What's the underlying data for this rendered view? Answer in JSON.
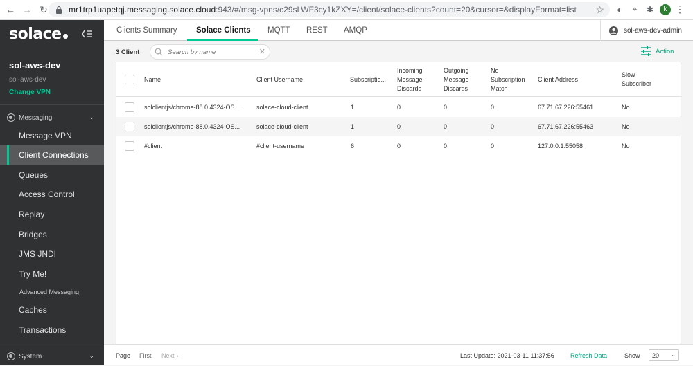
{
  "browser": {
    "url_host": "mr1trp1uapetqj.messaging.solace.cloud",
    "url_rest": ":943/#/msg-vpns/c29sLWF3cy1kZXY=/client/solace-clients?count=20&cursor=&displayFormat=list",
    "profile_initial": "k"
  },
  "sidebar": {
    "logo": "solace",
    "vpn_name": "sol-aws-dev",
    "vpn_sub": "sol-aws-dev",
    "change_vpn": "Change VPN",
    "section_messaging": "Messaging",
    "items": [
      {
        "label": "Message VPN"
      },
      {
        "label": "Client Connections"
      },
      {
        "label": "Queues"
      },
      {
        "label": "Access Control"
      },
      {
        "label": "Replay"
      },
      {
        "label": "Bridges"
      },
      {
        "label": "JMS JNDI"
      },
      {
        "label": "Try Me!"
      },
      {
        "label": "Advanced Messaging"
      },
      {
        "label": "Caches"
      },
      {
        "label": "Transactions"
      }
    ],
    "section_system": "System"
  },
  "tabs": [
    {
      "label": "Clients Summary"
    },
    {
      "label": "Solace Clients"
    },
    {
      "label": "MQTT"
    },
    {
      "label": "REST"
    },
    {
      "label": "AMQP"
    }
  ],
  "user": {
    "name": "sol-aws-dev-admin"
  },
  "toolbar": {
    "count": "3 Client",
    "search_placeholder": "Search by name",
    "action_label": "Action"
  },
  "table": {
    "headers": {
      "name": "Name",
      "username": "Client Username",
      "subscriptions": "Subscriptio...",
      "incoming_1": "Incoming",
      "incoming_2": "Message",
      "incoming_3": "Discards",
      "outgoing_1": "Outgoing",
      "outgoing_2": "Message",
      "outgoing_3": "Discards",
      "nosub_1": "No",
      "nosub_2": "Subscription",
      "nosub_3": "Match",
      "address": "Client Address",
      "slow_1": "Slow",
      "slow_2": "Subscriber"
    },
    "rows": [
      {
        "name": "solclientjs/chrome-88.0.4324-OS...",
        "username": "solace-cloud-client",
        "subscriptions": "1",
        "incoming": "0",
        "outgoing": "0",
        "nosub": "0",
        "address": "67.71.67.226:55461",
        "slow": "No"
      },
      {
        "name": "solclientjs/chrome-88.0.4324-OS...",
        "username": "solace-cloud-client",
        "subscriptions": "1",
        "incoming": "0",
        "outgoing": "0",
        "nosub": "0",
        "address": "67.71.67.226:55463",
        "slow": "No"
      },
      {
        "name": "#client",
        "username": "#client-username",
        "subscriptions": "6",
        "incoming": "0",
        "outgoing": "0",
        "nosub": "0",
        "address": "127.0.0.1:55058",
        "slow": "No"
      }
    ]
  },
  "footer": {
    "page": "Page",
    "first": "First",
    "next": "Next",
    "last_update": "Last Update: 2021-03-11 11:37:56",
    "refresh": "Refresh Data",
    "show": "Show",
    "show_value": "20"
  },
  "colors": {
    "accent": "#00c895",
    "sidebar_bg": "#2f3133"
  }
}
